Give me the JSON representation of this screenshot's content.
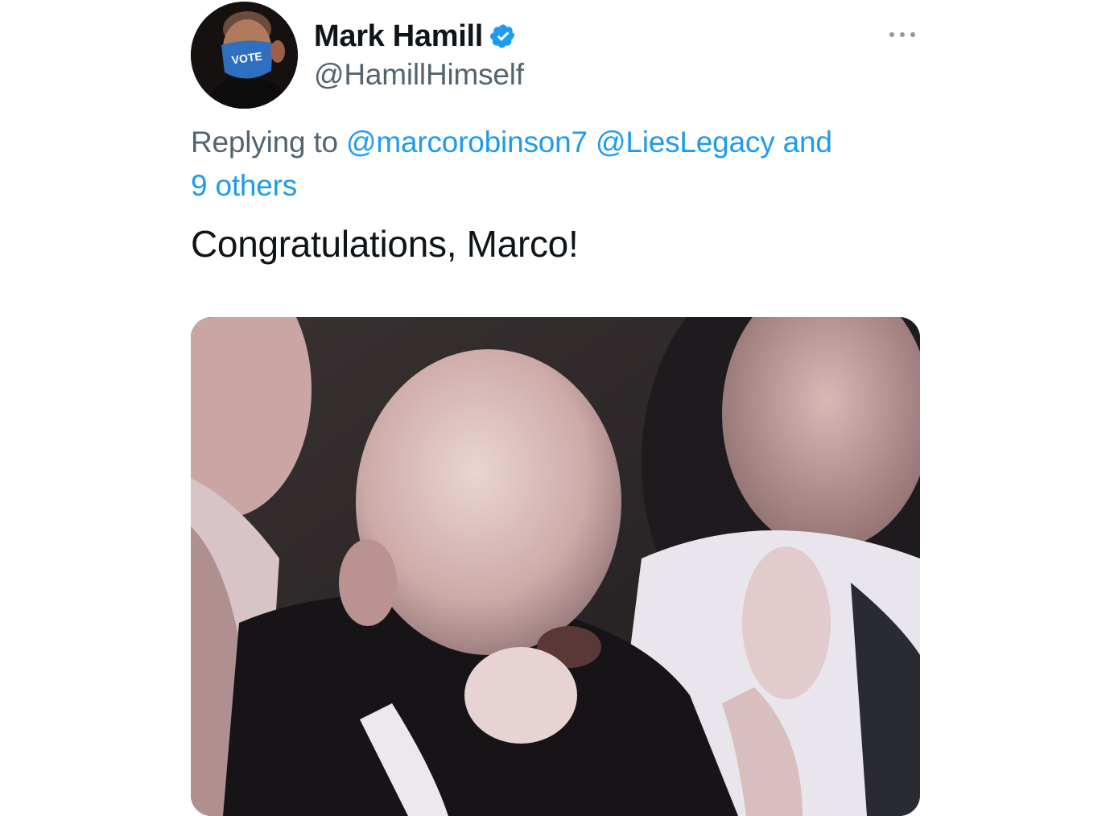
{
  "author": {
    "display_name": "Mark Hamill",
    "handle": "@HamillHimself",
    "avatar_mask_text": "VOTE",
    "verified": true
  },
  "reply": {
    "prefix": "Replying to",
    "mention_1": "@marcorobinson7",
    "mention_2": "@LiesLegacy",
    "and_word": "and",
    "others": "9 others"
  },
  "tweet": {
    "text": "Congratulations, Marco!"
  },
  "icons": {
    "verified": "verified-badge-icon",
    "more": "more-options-icon"
  },
  "colors": {
    "accent": "#1d9bf0",
    "text_primary": "#0f1419",
    "text_secondary": "#536471"
  }
}
